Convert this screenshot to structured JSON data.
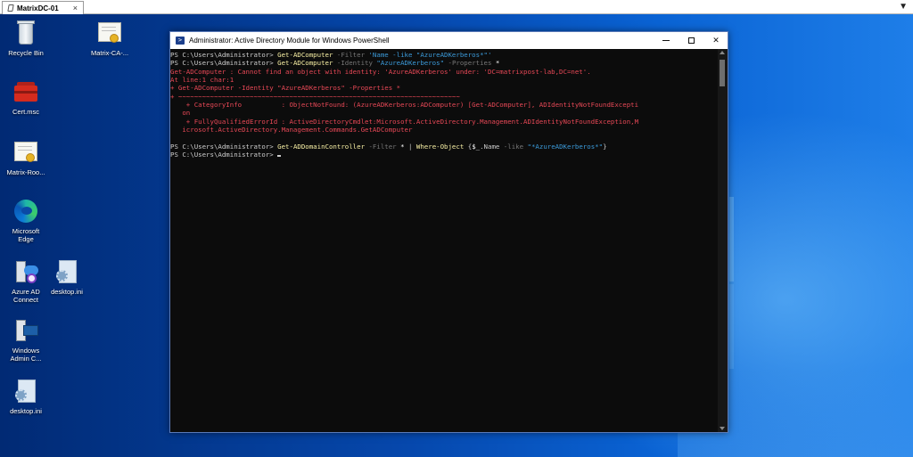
{
  "rdp": {
    "tab_label": "MatrixDC-01",
    "close_glyph": "×",
    "menu_glyph": "▼"
  },
  "desktop_icons": [
    {
      "label": "Recycle Bin",
      "icon": "recycle-bin-icon"
    },
    {
      "label": "Matrix-CA-...",
      "icon": "certificate-icon"
    },
    {
      "label": "Cert.msc",
      "icon": "toolbox-icon"
    },
    {
      "label": "Matrix-Roo...",
      "icon": "certificate-icon"
    },
    {
      "label": "Microsoft Edge",
      "icon": "edge-icon"
    },
    {
      "label": "Azure AD Connect",
      "icon": "azure-ad-connect-icon"
    },
    {
      "label": "desktop.ini",
      "icon": "ini-file-icon"
    },
    {
      "label": "Windows Admin C...",
      "icon": "windows-admin-center-icon"
    },
    {
      "label": "desktop.ini",
      "icon": "ini-file-icon"
    }
  ],
  "window": {
    "title": "Administrator: Active Directory Module for Windows PowerShell",
    "icon_glyph": ">",
    "close_glyph": "✕"
  },
  "console": {
    "lines": [
      [
        {
          "t": "PS C:\\Users\\Administrator> ",
          "c": "default"
        },
        {
          "t": "Get-ADComputer",
          "c": "y"
        },
        {
          "t": " -Filter ",
          "c": "g"
        },
        {
          "t": "'Name -like \"AzureADKerberos*\"'",
          "c": "c"
        }
      ],
      [
        {
          "t": "PS C:\\Users\\Administrator> ",
          "c": "default"
        },
        {
          "t": "Get-ADComputer",
          "c": "y"
        },
        {
          "t": " -Identity ",
          "c": "g"
        },
        {
          "t": "\"AzureADKerberos\"",
          "c": "c"
        },
        {
          "t": " -Properties ",
          "c": "g"
        },
        {
          "t": "*",
          "c": "w"
        }
      ],
      [
        {
          "t": "Get-ADComputer : Cannot find an object with identity: 'AzureADKerberos' under: 'DC=matrixpost-lab,DC=net'.",
          "c": "r"
        }
      ],
      [
        {
          "t": "At line:1 char:1",
          "c": "r"
        }
      ],
      [
        {
          "t": "+ Get-ADComputer -Identity \"AzureADKerberos\" -Properties *",
          "c": "r"
        }
      ],
      [
        {
          "t": "+ ~~~~~~~~~~~~~~~~~~~~~~~~~~~~~~~~~~~~~~~~~~~~~~~~~~~~~~~~~~~~~~~~~~~~~~~",
          "c": "r"
        }
      ],
      [
        {
          "t": "    + CategoryInfo          : ObjectNotFound: (AzureADKerberos:ADComputer) [Get-ADComputer], ADIdentityNotFoundExcepti",
          "c": "r"
        }
      ],
      [
        {
          "t": "   on",
          "c": "r"
        }
      ],
      [
        {
          "t": "    + FullyQualifiedErrorId : ActiveDirectoryCmdlet:Microsoft.ActiveDirectory.Management.ADIdentityNotFoundException,M",
          "c": "r"
        }
      ],
      [
        {
          "t": "   icrosoft.ActiveDirectory.Management.Commands.GetADComputer",
          "c": "r"
        }
      ],
      [
        {
          "t": "",
          "c": "default"
        }
      ],
      [
        {
          "t": "PS C:\\Users\\Administrator> ",
          "c": "default"
        },
        {
          "t": "Get-ADDomainController",
          "c": "y"
        },
        {
          "t": " -Filter ",
          "c": "g"
        },
        {
          "t": "*",
          "c": "w"
        },
        {
          "t": " | ",
          "c": "default"
        },
        {
          "t": "Where-Object",
          "c": "y"
        },
        {
          "t": " {",
          "c": "default"
        },
        {
          "t": "$_",
          "c": "w"
        },
        {
          "t": ".Name",
          "c": "default"
        },
        {
          "t": " -like ",
          "c": "g"
        },
        {
          "t": "\"*AzureADKerberos*\"",
          "c": "c"
        },
        {
          "t": "}",
          "c": "default"
        }
      ],
      [
        {
          "t": "PS C:\\Users\\Administrator> ",
          "c": "default"
        },
        {
          "t": "",
          "c": "cursor"
        }
      ]
    ]
  }
}
